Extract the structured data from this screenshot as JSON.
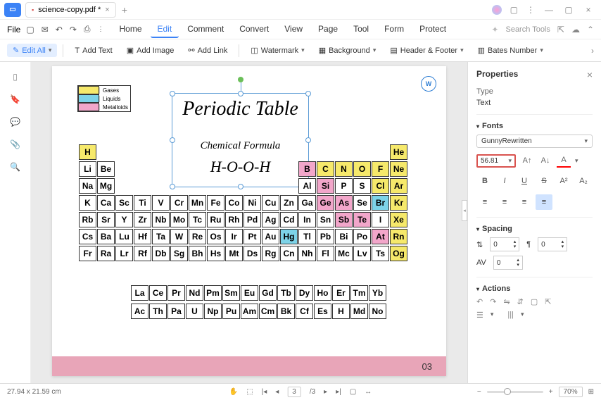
{
  "titlebar": {
    "tab_name": "science-copy.pdf *"
  },
  "menubar": {
    "file": "File",
    "items": [
      "Home",
      "Edit",
      "Comment",
      "Convert",
      "View",
      "Page",
      "Tool",
      "Form",
      "Protect"
    ],
    "active_index": 1,
    "search_placeholder": "Search Tools"
  },
  "toolbar": {
    "edit_all": "Edit All",
    "add_text": "Add Text",
    "add_image": "Add Image",
    "add_link": "Add Link",
    "watermark": "Watermark",
    "background": "Background",
    "header_footer": "Header & Footer",
    "bates": "Bates Number"
  },
  "document": {
    "legend": [
      {
        "color": "#f6e96b",
        "label": "Gases"
      },
      {
        "color": "#7dd3e8",
        "label": "Liquids"
      },
      {
        "color": "#f2a6ca",
        "label": "Metalloids"
      }
    ],
    "title": "Periodic Table",
    "subtitle": "Chemical Formula",
    "formula": "H-O-O-H",
    "page_number": "03"
  },
  "periodic_table": {
    "main_rows": [
      [
        {
          "s": "H",
          "c": "yellow",
          "x": 0
        },
        {
          "s": "He",
          "c": "yellow",
          "x": 17
        }
      ],
      [
        {
          "s": "Li",
          "x": 0
        },
        {
          "s": "Be",
          "x": 1
        },
        {
          "s": "B",
          "c": "pink",
          "x": 12
        },
        {
          "s": "C",
          "c": "yellow",
          "x": 13
        },
        {
          "s": "N",
          "c": "yellow",
          "x": 14
        },
        {
          "s": "O",
          "c": "yellow",
          "x": 15
        },
        {
          "s": "F",
          "c": "yellow",
          "x": 16
        },
        {
          "s": "Ne",
          "c": "yellow",
          "x": 17
        }
      ],
      [
        {
          "s": "Na",
          "x": 0
        },
        {
          "s": "Mg",
          "x": 1
        },
        {
          "s": "Al",
          "x": 12
        },
        {
          "s": "Si",
          "c": "pink",
          "x": 13
        },
        {
          "s": "P",
          "x": 14
        },
        {
          "s": "S",
          "x": 15
        },
        {
          "s": "Cl",
          "c": "yellow",
          "x": 16
        },
        {
          "s": "Ar",
          "c": "yellow",
          "x": 17
        }
      ],
      [
        {
          "s": "K",
          "x": 0
        },
        {
          "s": "Ca",
          "x": 1
        },
        {
          "s": "Sc",
          "x": 2
        },
        {
          "s": "Ti",
          "x": 3
        },
        {
          "s": "V",
          "x": 4
        },
        {
          "s": "Cr",
          "x": 5
        },
        {
          "s": "Mn",
          "x": 6
        },
        {
          "s": "Fe",
          "x": 7
        },
        {
          "s": "Co",
          "x": 8
        },
        {
          "s": "Ni",
          "x": 9
        },
        {
          "s": "Cu",
          "x": 10
        },
        {
          "s": "Zn",
          "x": 11
        },
        {
          "s": "Ga",
          "x": 12
        },
        {
          "s": "Ge",
          "c": "pink",
          "x": 13
        },
        {
          "s": "As",
          "c": "pink",
          "x": 14
        },
        {
          "s": "Se",
          "x": 15
        },
        {
          "s": "Br",
          "c": "blue",
          "x": 16
        },
        {
          "s": "Kr",
          "c": "yellow",
          "x": 17
        }
      ],
      [
        {
          "s": "Rb",
          "x": 0
        },
        {
          "s": "Sr",
          "x": 1
        },
        {
          "s": "Y",
          "x": 2
        },
        {
          "s": "Zr",
          "x": 3
        },
        {
          "s": "Nb",
          "x": 4
        },
        {
          "s": "Mo",
          "x": 5
        },
        {
          "s": "Tc",
          "x": 6
        },
        {
          "s": "Ru",
          "x": 7
        },
        {
          "s": "Rh",
          "x": 8
        },
        {
          "s": "Pd",
          "x": 9
        },
        {
          "s": "Ag",
          "x": 10
        },
        {
          "s": "Cd",
          "x": 11
        },
        {
          "s": "In",
          "x": 12
        },
        {
          "s": "Sn",
          "x": 13
        },
        {
          "s": "Sb",
          "c": "pink",
          "x": 14
        },
        {
          "s": "Te",
          "c": "pink",
          "x": 15
        },
        {
          "s": "I",
          "x": 16
        },
        {
          "s": "Xe",
          "c": "yellow",
          "x": 17
        }
      ],
      [
        {
          "s": "Cs",
          "x": 0
        },
        {
          "s": "Ba",
          "x": 1
        },
        {
          "s": "Lu",
          "x": 2
        },
        {
          "s": "Hf",
          "x": 3
        },
        {
          "s": "Ta",
          "x": 4
        },
        {
          "s": "W",
          "x": 5
        },
        {
          "s": "Re",
          "x": 6
        },
        {
          "s": "Os",
          "x": 7
        },
        {
          "s": "Ir",
          "x": 8
        },
        {
          "s": "Pt",
          "x": 9
        },
        {
          "s": "Au",
          "x": 10
        },
        {
          "s": "Hg",
          "c": "blue",
          "x": 11
        },
        {
          "s": "Tl",
          "x": 12
        },
        {
          "s": "Pb",
          "x": 13
        },
        {
          "s": "Bi",
          "x": 14
        },
        {
          "s": "Po",
          "x": 15
        },
        {
          "s": "At",
          "c": "pink",
          "x": 16
        },
        {
          "s": "Rn",
          "c": "yellow",
          "x": 17
        }
      ],
      [
        {
          "s": "Fr",
          "x": 0
        },
        {
          "s": "Ra",
          "x": 1
        },
        {
          "s": "Lr",
          "x": 2
        },
        {
          "s": "Rf",
          "x": 3
        },
        {
          "s": "Db",
          "x": 4
        },
        {
          "s": "Sg",
          "x": 5
        },
        {
          "s": "Bh",
          "x": 6
        },
        {
          "s": "Hs",
          "x": 7
        },
        {
          "s": "Mt",
          "x": 8
        },
        {
          "s": "Ds",
          "x": 9
        },
        {
          "s": "Rg",
          "x": 10
        },
        {
          "s": "Cn",
          "x": 11
        },
        {
          "s": "Nh",
          "x": 12
        },
        {
          "s": "Fl",
          "x": 13
        },
        {
          "s": "Mc",
          "x": 14
        },
        {
          "s": "Lv",
          "x": 15
        },
        {
          "s": "Ts",
          "x": 16
        },
        {
          "s": "Og",
          "c": "yellow",
          "x": 17
        }
      ]
    ],
    "lanth_row": [
      "La",
      "Ce",
      "Pr",
      "Nd",
      "Pm",
      "Sm",
      "Eu",
      "Gd",
      "Tb",
      "Dy",
      "Ho",
      "Er",
      "Tm",
      "Yb"
    ],
    "actin_row": [
      "Ac",
      "Th",
      "Pa",
      "U",
      "Np",
      "Pu",
      "Am",
      "Cm",
      "Bk",
      "Cf",
      "Es",
      "H",
      "Md",
      "No"
    ]
  },
  "properties": {
    "title": "Properties",
    "type_label": "Type",
    "type_value": "Text",
    "fonts_label": "Fonts",
    "font_name": "GunnyRewritten",
    "font_size": "56.81",
    "spacing_label": "Spacing",
    "spacing_val1": "0",
    "spacing_val2": "0",
    "spacing_val3": "0",
    "actions_label": "Actions"
  },
  "statusbar": {
    "dimensions": "27.94 x 21.59 cm",
    "page_current": "3",
    "page_total": "/3",
    "zoom": "70%"
  }
}
